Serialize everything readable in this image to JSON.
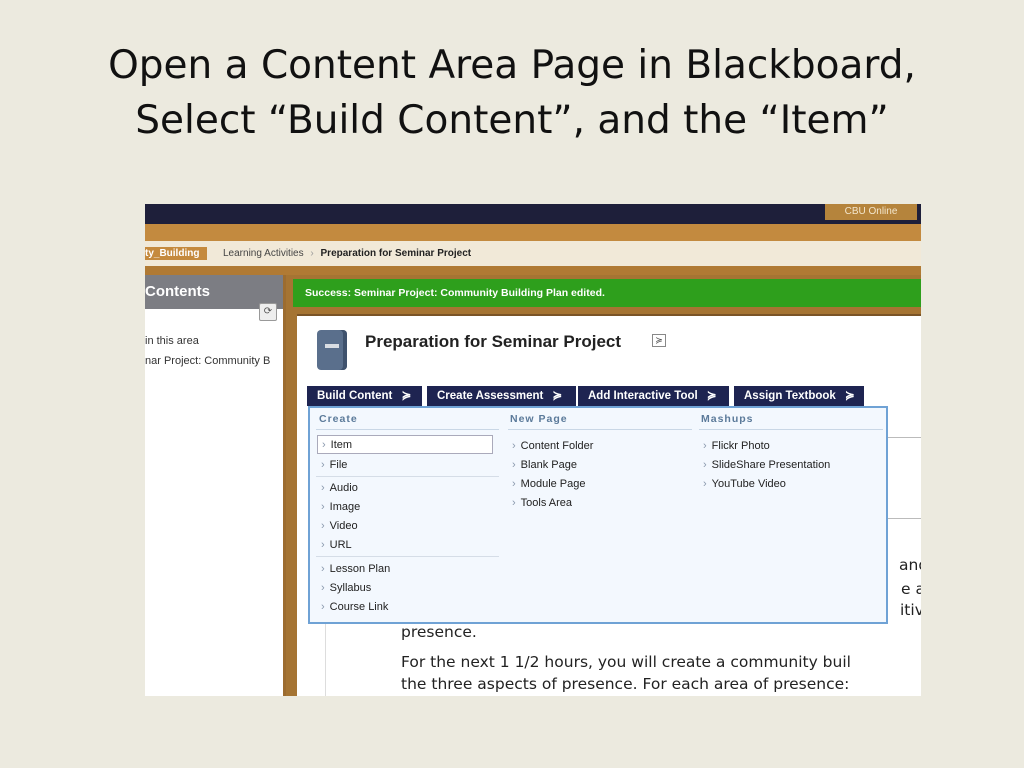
{
  "slide": {
    "title_line1": "Open a Content Area Page in Blackboard,",
    "title_line2": "Select “Build Content”, and the “Item”"
  },
  "topbar": {
    "cbu_label": "CBU Online"
  },
  "breadcrumb": {
    "course": "ty_Building",
    "middle": "Learning Activities",
    "separator": "›",
    "current": "Preparation for Seminar Project"
  },
  "sidebar": {
    "header": "Contents",
    "refresh_icon": "refresh-icon",
    "line1": "in this area",
    "line2": "nar Project: Community B"
  },
  "success": {
    "message": "Success: Seminar Project: Community Building Plan edited."
  },
  "page": {
    "title": "Preparation for Seminar Project",
    "menu_icon": "chevron-double-down-icon"
  },
  "action_bar": [
    {
      "label": "Build Content",
      "chevron": "≽"
    },
    {
      "label": "Create Assessment",
      "chevron": "≽"
    },
    {
      "label": "Add Interactive Tool",
      "chevron": "≽"
    },
    {
      "label": "Assign Textbook",
      "chevron": "≽"
    }
  ],
  "menu": {
    "create": {
      "heading": "Create",
      "items": [
        "Item",
        "File",
        "Audio",
        "Image",
        "Video",
        "URL",
        "Lesson Plan",
        "Syllabus",
        "Course Link"
      ]
    },
    "new_page": {
      "heading": "New Page",
      "items": [
        "Content Folder",
        "Blank Page",
        "Module Page",
        "Tools Area"
      ]
    },
    "mashups": {
      "heading": "Mashups",
      "items": [
        "Flickr Photo",
        "SlideShare Presentation",
        "YouTube Video"
      ]
    },
    "item_chevron": "›"
  },
  "body": {
    "frag1": "and",
    "frag2": "e an",
    "frag3": "itiv",
    "line_presence": "presence.",
    "line_next": "For the next 1 1/2 hours, you will create a community buil",
    "line_three": "the three aspects of presence. For each area of presence:"
  },
  "colors": {
    "accent_gold": "#C38A3F",
    "action_navy": "#1E2451",
    "success_green": "#2E9F1C",
    "menu_border": "#6FA2D5"
  }
}
